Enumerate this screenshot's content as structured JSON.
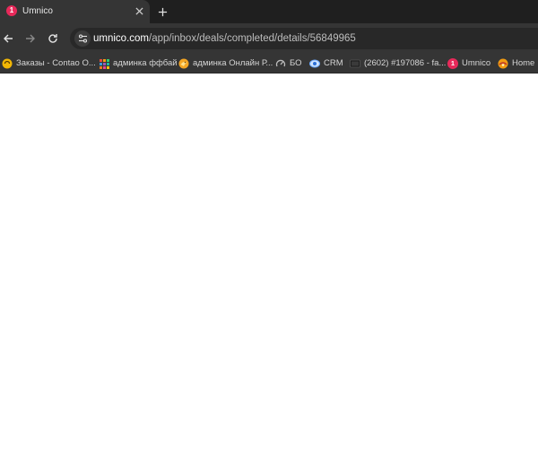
{
  "tab": {
    "title": "Umnico",
    "favicon_text": "1",
    "favicon_color": "#e8295a",
    "close_icon": "close-icon",
    "new_tab_icon": "plus-icon"
  },
  "toolbar": {
    "back_icon": "arrow-left-icon",
    "forward_icon": "arrow-right-icon",
    "reload_icon": "reload-icon",
    "site_info_icon": "tune-icon",
    "url_host": "umnico.com",
    "url_path": "/app/inbox/deals/completed/details/56849965"
  },
  "bookmarks": [
    {
      "label": "Заказы - Contao O...",
      "icon": "contao-icon"
    },
    {
      "label": "админка ффбай",
      "icon": "grid-icon"
    },
    {
      "label": "админка Онлайн Р...",
      "icon": "bird-icon"
    },
    {
      "label": "БО",
      "icon": "speedometer-icon"
    },
    {
      "label": "CRM",
      "icon": "eye-icon"
    },
    {
      "label": "(2602) #197086 - fa...",
      "icon": "monitor-icon"
    },
    {
      "label": "Umnico",
      "icon": "umnico-icon",
      "icon_text": "1"
    },
    {
      "label": "Home",
      "icon": "home-logo-icon"
    }
  ]
}
